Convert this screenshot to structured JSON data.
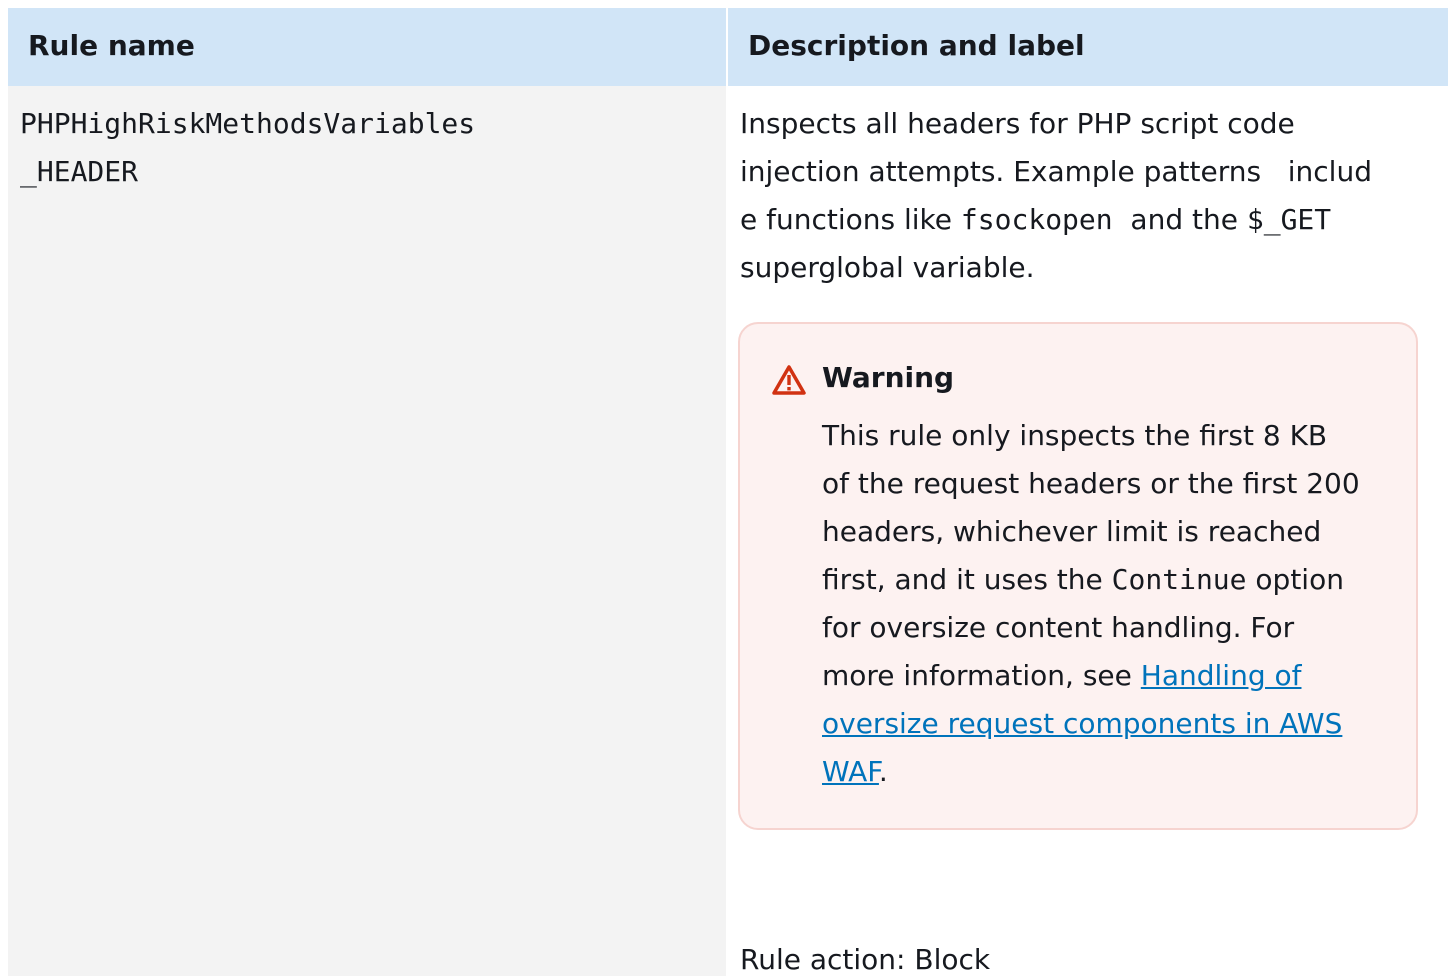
{
  "table": {
    "headers": {
      "rule_name": "Rule name",
      "description": "Description and label"
    },
    "row": {
      "rule_name_lines": [
        "PHPHighRiskMethodsVariables",
        "_HEADER"
      ],
      "description": {
        "line1": "Inspects all headers for PHP script code",
        "line2": "injection attempts. Example patterns   includ",
        "line3_pre": "e functions like ",
        "line3_code1": "fsockopen",
        "line3_mid": "  and the ",
        "line3_code2": "$_GET",
        "line4": "superglobal variable."
      },
      "warning": {
        "icon": "warning-triangle-icon",
        "title": "Warning",
        "line1": "This rule only inspects the first 8 KB",
        "line2": "of the request headers or the first 200",
        "line3": "headers, whichever limit is reached",
        "line4_pre": "first, and it uses the ",
        "line4_code": "Continue",
        "line4_post": " option",
        "line5": "for oversize content handling. For",
        "line6_pre": "more information, see ",
        "link_line1": "Handling of",
        "link_line2": "oversize request components in AWS",
        "link_line3": "WAF",
        "final_period": "."
      },
      "rule_action": "Rule action: Block"
    }
  },
  "colors": {
    "header_bg": "#d1e5f7",
    "warning_bg": "#fdf2f1",
    "warning_border": "#f6d4d0",
    "warning_icon": "#d13212",
    "link": "#0073bb"
  }
}
